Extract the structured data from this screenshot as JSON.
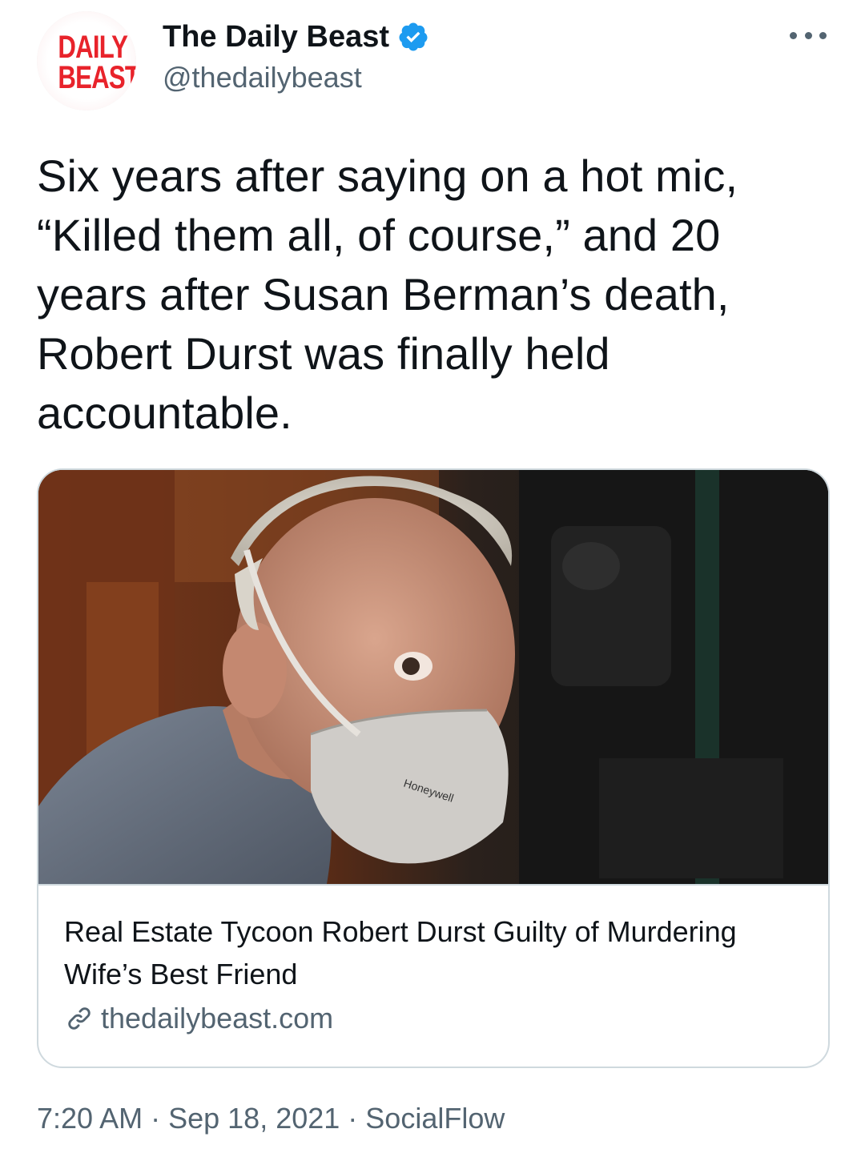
{
  "author": {
    "avatar_logo_line1": "DAILY",
    "avatar_logo_line2": "BEAST",
    "display_name": "The Daily Beast",
    "handle": "@thedailybeast",
    "verified": true
  },
  "tweet": {
    "lines": [
      "Six years after saying on a hot mic,",
      "“Killed them all, of course,” and 20",
      "years after Susan Berman’s death,",
      "Robert Durst was finally held",
      "accountable."
    ]
  },
  "card": {
    "title_line1": "Real Estate Tycoon Robert Durst Guilty of Murdering",
    "title_line2": "Wife’s Best Friend",
    "domain": "thedailybeast.com",
    "image_description_icon": "photo-of-man-in-face-mask"
  },
  "meta": {
    "time": "7:20 AM",
    "separator": "·",
    "date": "Sep 18, 2021",
    "source": "SocialFlow"
  },
  "colors": {
    "text_primary": "#0f1419",
    "text_secondary": "#536471",
    "verified_blue": "#1d9bf0",
    "brand_red": "#e8232b",
    "border": "#cfd9de"
  }
}
